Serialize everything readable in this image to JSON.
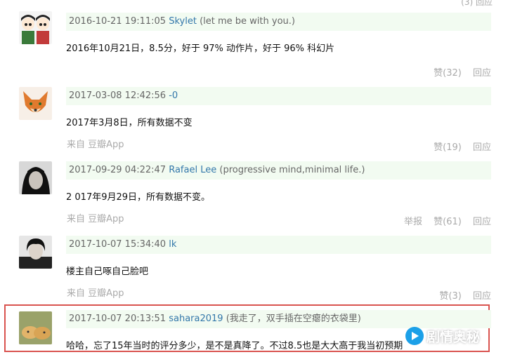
{
  "top_cut": "(3) 回应",
  "comments": [
    {
      "time": "2016-10-21 19:11:05",
      "user": "Skylet",
      "signature": "(let me be with you.)",
      "text": "2016年10月21日，8.5分，好于 97% 动作片，好于 96% 科幻片",
      "source": "",
      "report": "",
      "likes": "赞(32)",
      "reply": "回应"
    },
    {
      "time": "2017-03-08 12:42:56",
      "user": "-0",
      "signature": "",
      "text": "2017年3月8日，所有数据不变",
      "source": "来自 豆瓣App",
      "report": "",
      "likes": "赞(19)",
      "reply": "回应"
    },
    {
      "time": "2017-09-29 04:22:47",
      "user": "Rafael Lee",
      "signature": "(progressive mind,minimal life.)",
      "text": "2 017年9月29日，所有数据不变。",
      "source": "来自 豆瓣App",
      "report": "举报",
      "likes": "赞(61)",
      "reply": "回应"
    },
    {
      "time": "2017-10-07 15:34:40",
      "user": "lk",
      "signature": "",
      "text": "楼主自己啄自己脸吧",
      "source": "来自 豆瓣App",
      "report": "",
      "likes": "赞(3)",
      "reply": "回应"
    },
    {
      "time": "2017-10-07 20:13:51",
      "user": "sahara2019",
      "signature": "(我走了，双手插在空瘪的衣袋里)",
      "text": "哈哈，忘了15年当时的评分多少，是不是真降了。不过8.5也是大大高于我当初预期",
      "source": "",
      "report": "",
      "likes": "",
      "reply": ""
    }
  ],
  "watermark": "剧情奥秘",
  "colors": {
    "header_bg": "#f2fbf1",
    "link": "#3377aa",
    "muted": "#aaaaaa",
    "highlight": "#d9534f"
  }
}
